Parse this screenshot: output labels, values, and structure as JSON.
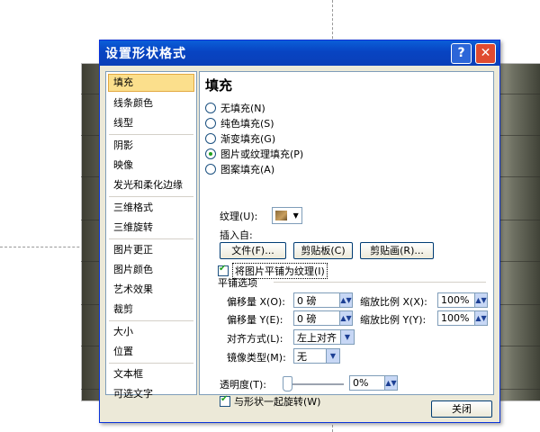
{
  "dialog": {
    "title": "设置形状格式",
    "help_glyph": "?",
    "close_glyph": "✕",
    "close_button": "关闭"
  },
  "sidebar": {
    "items": [
      {
        "label": "填充",
        "active": true
      },
      {
        "label": "线条颜色"
      },
      {
        "label": "线型"
      },
      {
        "label": "阴影"
      },
      {
        "label": "映像"
      },
      {
        "label": "发光和柔化边缘"
      },
      {
        "label": "三维格式"
      },
      {
        "label": "三维旋转"
      },
      {
        "label": "图片更正"
      },
      {
        "label": "图片颜色"
      },
      {
        "label": "艺术效果"
      },
      {
        "label": "裁剪"
      },
      {
        "label": "大小"
      },
      {
        "label": "位置"
      },
      {
        "label": "文本框"
      },
      {
        "label": "可选文字"
      }
    ]
  },
  "fill": {
    "title": "填充",
    "options": [
      {
        "label": "无填充(N)",
        "checked": false
      },
      {
        "label": "纯色填充(S)",
        "checked": false
      },
      {
        "label": "渐变填充(G)",
        "checked": false
      },
      {
        "label": "图片或纹理填充(P)",
        "checked": true
      },
      {
        "label": "图案填充(A)",
        "checked": false
      }
    ],
    "texture_label": "纹理(U):",
    "texture_arrow": "▼",
    "insert_from_label": "插入自:",
    "file_button": "文件(F)...",
    "clipboard_button": "剪贴板(C)",
    "clipart_button": "剪贴画(R)...",
    "tile_checkbox": {
      "label": "将图片平铺为纹理(I)",
      "checked": true
    },
    "tiling_section": "平铺选项",
    "offset_x_label": "偏移量 X(O):",
    "offset_x_value": "0 磅",
    "scale_x_label": "缩放比例 X(X):",
    "scale_x_value": "100%",
    "offset_y_label": "偏移量 Y(E):",
    "offset_y_value": "0 磅",
    "scale_y_label": "缩放比例 Y(Y):",
    "scale_y_value": "100%",
    "alignment_label": "对齐方式(L):",
    "alignment_value": "左上对齐",
    "mirror_label": "镜像类型(M):",
    "mirror_value": "无",
    "transparency_label": "透明度(T):",
    "transparency_value": "0%",
    "transparency_fraction": 0,
    "rotate_checkbox": {
      "label": "与形状一起旋转(W)",
      "checked": true
    },
    "spin_arrows": "▲▼",
    "dropdown_arrow": "▼"
  }
}
